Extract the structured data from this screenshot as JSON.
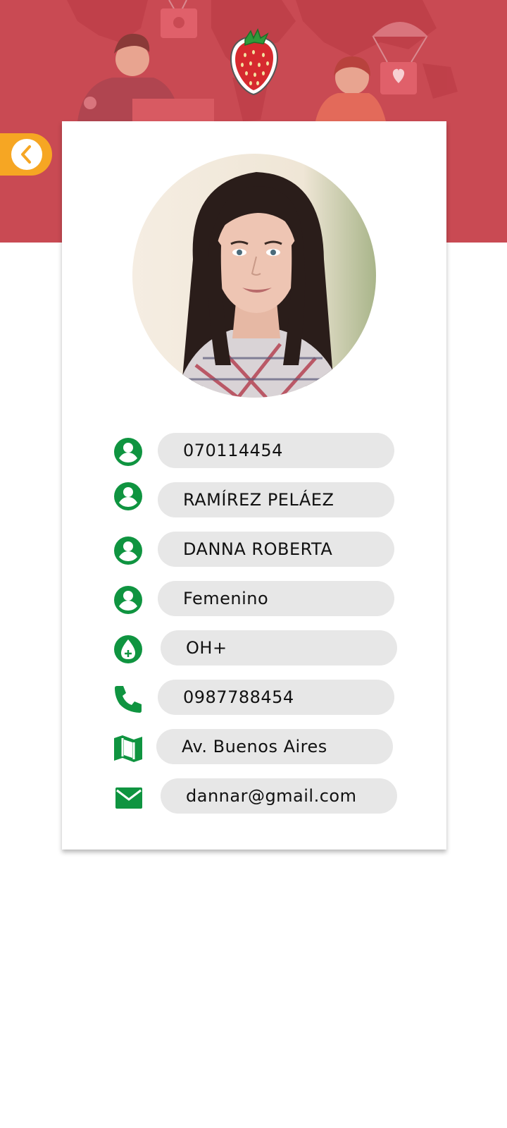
{
  "colors": {
    "header": "#c94a53",
    "accent_green": "#0f9440",
    "back_button": "#f6a623",
    "field_bg": "#e7e7e7",
    "text": "#111111"
  },
  "header": {
    "logo_icon": "strawberry-icon",
    "back_icon": "chevron-left-icon"
  },
  "profile": {
    "photo": "profile-photo"
  },
  "fields": [
    {
      "id": "cedula",
      "icon": "person-icon",
      "value": "070114454"
    },
    {
      "id": "apellidos",
      "icon": "person-icon",
      "value": "RAMÍREZ PELÁEZ"
    },
    {
      "id": "nombres",
      "icon": "person-icon",
      "value": "DANNA ROBERTA"
    },
    {
      "id": "genero",
      "icon": "person-icon",
      "value": "Femenino"
    },
    {
      "id": "tipo-sangre",
      "icon": "blood-drop-icon",
      "value": "OH+"
    },
    {
      "id": "telefono",
      "icon": "phone-icon",
      "value": "0987788454"
    },
    {
      "id": "direccion",
      "icon": "map-icon",
      "value": "Av. Buenos Aires"
    },
    {
      "id": "email",
      "icon": "mail-icon",
      "value": "dannar@gmail.com"
    }
  ]
}
